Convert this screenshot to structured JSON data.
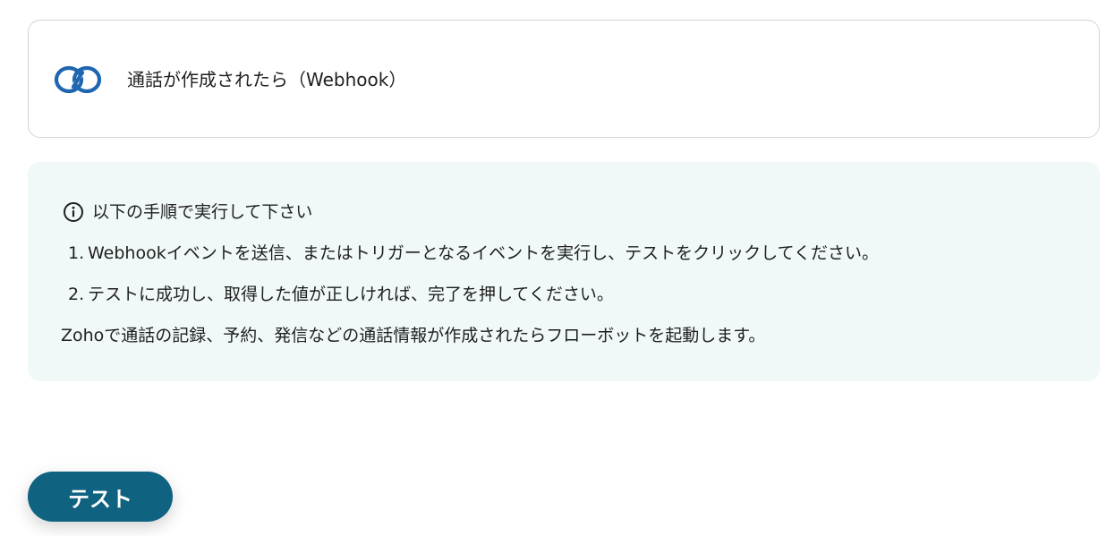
{
  "trigger": {
    "icon": "zoho-link-icon",
    "title": "通話が作成されたら（Webhook）"
  },
  "info": {
    "icon": "info-icon",
    "heading": "以下の手順で実行して下さい",
    "steps": [
      {
        "number": "1.",
        "text": "Webhookイベントを送信、またはトリガーとなるイベントを実行し、テストをクリックしてください。"
      },
      {
        "number": "2.",
        "text": "テストに成功し、取得した値が正しければ、完了を押してください。"
      }
    ],
    "description": "Zohoで通話の記録、予約、発信などの通話情報が作成されたらフローボットを起動します。"
  },
  "test_button": {
    "label": "テスト"
  },
  "colors": {
    "accent": "#0f6280",
    "icon_blue": "#1f66b0",
    "panel_bg": "#f1f8f8",
    "card_border": "#d4d4d4"
  }
}
